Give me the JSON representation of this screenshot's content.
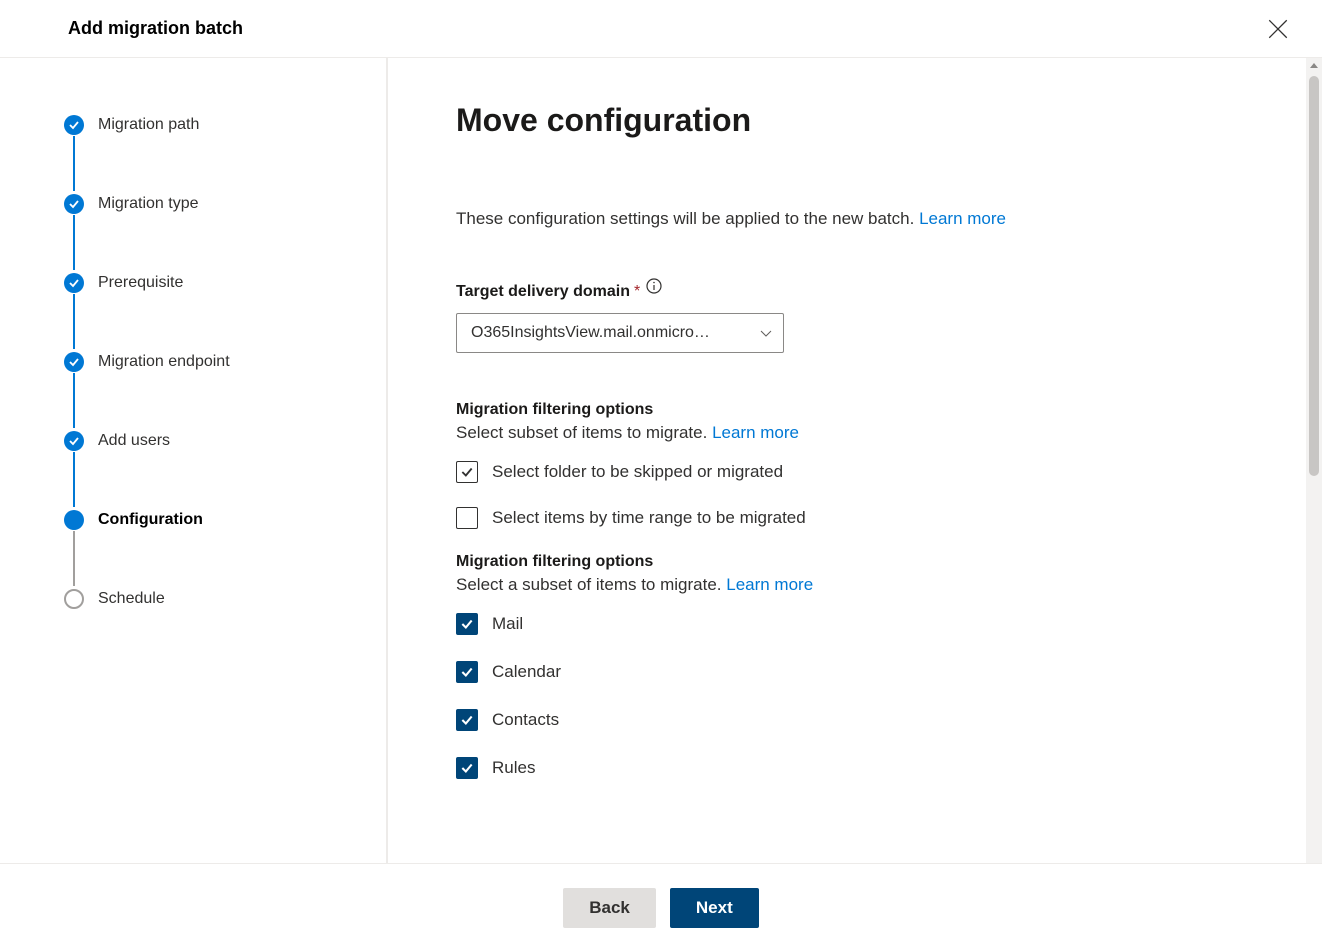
{
  "header": {
    "title": "Add migration batch"
  },
  "sidebar": {
    "steps": [
      {
        "label": "Migration path",
        "state": "completed"
      },
      {
        "label": "Migration type",
        "state": "completed"
      },
      {
        "label": "Prerequisite",
        "state": "completed"
      },
      {
        "label": "Migration endpoint",
        "state": "completed"
      },
      {
        "label": "Add users",
        "state": "completed"
      },
      {
        "label": "Configuration",
        "state": "current"
      },
      {
        "label": "Schedule",
        "state": "pending"
      }
    ]
  },
  "main": {
    "heading": "Move configuration",
    "intro_text": "These configuration settings will be applied to the new batch. ",
    "intro_link": "Learn more",
    "target_domain": {
      "label": "Target delivery domain",
      "value": "O365InsightsView.mail.onmicro…"
    },
    "filter_section1": {
      "title": "Migration filtering options",
      "desc": "Select subset of items to migrate. ",
      "desc_link": "Learn more",
      "opt_folder": {
        "label": "Select folder to be skipped or migrated",
        "checked": true,
        "style": "light"
      },
      "opt_time": {
        "label": "Select items by time range to be migrated",
        "checked": false
      }
    },
    "filter_section2": {
      "title": "Migration filtering options",
      "desc": "Select a subset of items to migrate. ",
      "desc_link": "Learn more",
      "items": [
        {
          "label": "Mail",
          "checked": true
        },
        {
          "label": "Calendar",
          "checked": true
        },
        {
          "label": "Contacts",
          "checked": true
        },
        {
          "label": "Rules",
          "checked": true
        }
      ]
    }
  },
  "footer": {
    "back": "Back",
    "next": "Next"
  }
}
